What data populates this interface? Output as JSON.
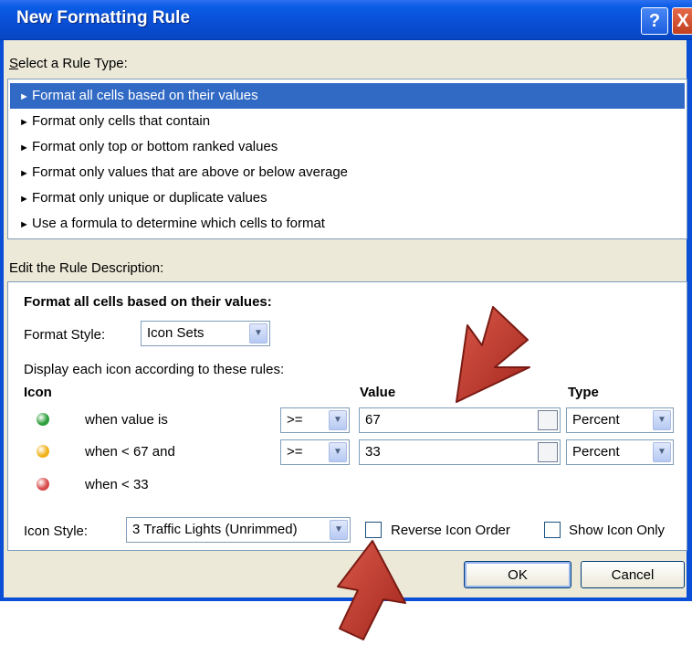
{
  "window": {
    "title": "New Formatting Rule",
    "help_glyph": "?",
    "close_glyph": "X"
  },
  "rule_type": {
    "label": "Select a Rule Type:",
    "label_access_key": "S",
    "items": [
      {
        "label": "Format all cells based on their values",
        "selected": true
      },
      {
        "label": "Format only cells that contain",
        "selected": false
      },
      {
        "label": "Format only top or bottom ranked values",
        "selected": false
      },
      {
        "label": "Format only values that are above or below average",
        "selected": false
      },
      {
        "label": "Format only unique or duplicate values",
        "selected": false
      },
      {
        "label": "Use a formula to determine which cells to format",
        "selected": false
      }
    ],
    "item_glyph": "►"
  },
  "description": {
    "label": "Edit the Rule Description:",
    "heading": "Format all cells based on their values:",
    "format_style_label": "Format Style:",
    "format_style_value": "Icon Sets",
    "display_rule_text": "Display each icon according to these rules:",
    "headers": {
      "icon": "Icon",
      "value": "Value",
      "type": "Type"
    },
    "rows": [
      {
        "icon_color": "#2e9e3c",
        "condition": "when value is",
        "operator": ">=",
        "value": "67",
        "type": "Percent"
      },
      {
        "icon_color": "#f0b21b",
        "condition": "when < 67 and",
        "operator": ">=",
        "value": "33",
        "type": "Percent"
      },
      {
        "icon_color": "#d84a4a",
        "condition": "when < 33"
      }
    ],
    "icon_style_label": "Icon Style:",
    "icon_style_value": "3 Traffic Lights (Unrimmed)",
    "reverse_icon_order_label": "Reverse Icon Order",
    "reverse_icon_order_checked": false,
    "show_icon_only_label": "Show Icon Only",
    "show_icon_only_checked": false
  },
  "buttons": {
    "ok": "OK",
    "cancel": "Cancel"
  },
  "colors": {
    "title_bar": "#0a4fd6",
    "dialog_bg": "#ece9d8",
    "selection": "#316ac5",
    "annotation_arrow": "#c0392b"
  }
}
